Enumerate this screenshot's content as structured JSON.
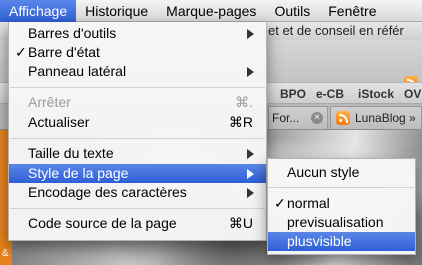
{
  "menubar": {
    "items": [
      {
        "label": "Affichage",
        "selected": true
      },
      {
        "label": "Historique"
      },
      {
        "label": "Marque-pages"
      },
      {
        "label": "Outils"
      },
      {
        "label": "Fenêtre"
      }
    ]
  },
  "background": {
    "window_title": "et et de conseil en référ",
    "bookmarks": [
      "BPO",
      "e-CB",
      "iStock",
      "OV"
    ],
    "tabs": [
      {
        "label": "For...",
        "close": "×"
      },
      {
        "label": "LunaBlog »"
      }
    ],
    "side_strip_text": "&"
  },
  "menu": {
    "items": [
      {
        "label": "Barres d'outils",
        "submenu": true
      },
      {
        "label": "Barre d'état",
        "checked": true,
        "check": "✓"
      },
      {
        "label": "Panneau latéral",
        "submenu": true
      },
      {
        "label": "Arrêter",
        "shortcut": "⌘.",
        "disabled": true
      },
      {
        "label": "Actualiser",
        "shortcut": "⌘R"
      },
      {
        "label": "Taille du texte",
        "submenu": true
      },
      {
        "label": "Style de la page",
        "submenu": true,
        "highlighted": true
      },
      {
        "label": "Encodage des caractères",
        "submenu": true
      },
      {
        "label": "Code source de la page",
        "shortcut": "⌘U"
      }
    ]
  },
  "submenu": {
    "items": [
      {
        "label": "Aucun style"
      },
      {
        "label": "normal",
        "checked": true,
        "check": "✓"
      },
      {
        "label": "previsualisation"
      },
      {
        "label": "plusvisible",
        "highlighted": true
      }
    ]
  },
  "colors": {
    "highlight": "#2f5fd6",
    "menu_bg": "#f6f6f6",
    "rss_orange": "#f07a10"
  }
}
